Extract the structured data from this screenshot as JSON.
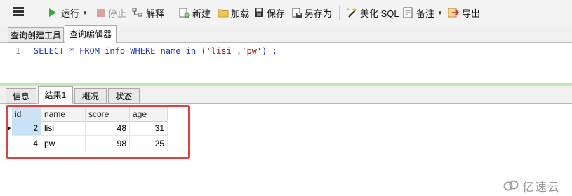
{
  "toolbar": {
    "run": "运行",
    "stop": "停止",
    "explain": "解释",
    "new": "新建",
    "load": "加载",
    "save": "保存",
    "save_as": "另存为",
    "beautify": "美化 SQL",
    "note": "备注",
    "export": "导出"
  },
  "editor_tabs": [
    "查询创建工具",
    "查询编辑器"
  ],
  "editor": {
    "line_number": "1",
    "sql_parts": [
      "SELECT * FROM info WHERE name in (",
      "'lisi'",
      ",",
      "'pw'",
      ") ;"
    ]
  },
  "result_tabs": [
    "信息",
    "结果1",
    "概况",
    "状态"
  ],
  "grid": {
    "columns": [
      "id",
      "name",
      "score",
      "age"
    ],
    "rows": [
      [
        "2",
        "lisi",
        "48",
        "31"
      ],
      [
        "4",
        "pw",
        "98",
        "25"
      ]
    ]
  },
  "watermark": "亿速云",
  "colors": {
    "run_icon": "#3aa83a",
    "highlight_box": "#e04040",
    "editor_separator": "#c7e7b5",
    "selected_cell": "#c9e1f7"
  }
}
